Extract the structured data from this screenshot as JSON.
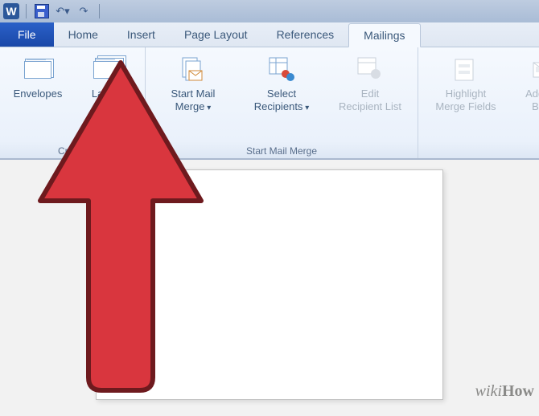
{
  "app": {
    "letter": "W"
  },
  "qat": {
    "save_name": "save-icon",
    "undo_name": "undo-icon",
    "redo_name": "redo-icon"
  },
  "tabs": {
    "file": "File",
    "items": [
      {
        "label": "Home"
      },
      {
        "label": "Insert"
      },
      {
        "label": "Page Layout"
      },
      {
        "label": "References"
      },
      {
        "label": "Mailings",
        "active": true
      }
    ]
  },
  "ribbon": {
    "groups": [
      {
        "label": "Create",
        "buttons": [
          {
            "label": "Envelopes",
            "name": "envelopes-button"
          },
          {
            "label": "Labels",
            "name": "labels-button"
          }
        ]
      },
      {
        "label": "Start Mail Merge",
        "buttons": [
          {
            "label1": "Start Mail",
            "label2": "Merge",
            "dd": true,
            "name": "start-mail-merge-button"
          },
          {
            "label1": "Select",
            "label2": "Recipients",
            "dd": true,
            "name": "select-recipients-button"
          },
          {
            "label1": "Edit",
            "label2": "Recipient List",
            "name": "edit-recipient-list-button",
            "disabled": true
          }
        ]
      },
      {
        "label": "",
        "buttons": [
          {
            "label1": "Highlight",
            "label2": "Merge Fields",
            "name": "highlight-merge-fields-button",
            "disabled": true
          },
          {
            "label1": "Address",
            "label2": "Block",
            "name": "address-block-button",
            "disabled": true
          }
        ]
      }
    ]
  },
  "watermark": {
    "prefix": "wiki",
    "suffix": "How"
  }
}
